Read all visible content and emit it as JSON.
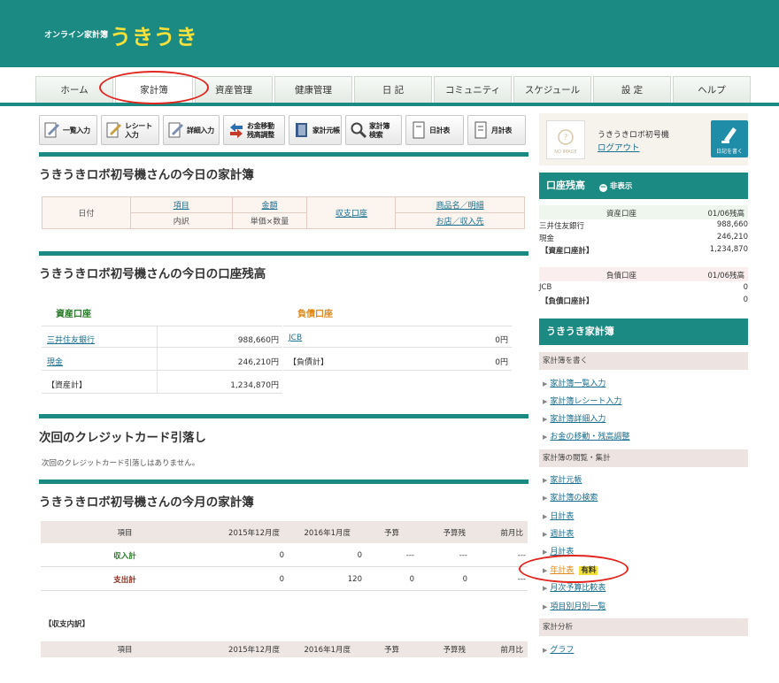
{
  "header": {
    "sub": "オンライン家計簿",
    "brand": "うきうき"
  },
  "tabs": [
    "ホーム",
    "家計簿",
    "資産管理",
    "健康管理",
    "日 記",
    "コミュニティ",
    "スケジュール",
    "設 定",
    "ヘルプ"
  ],
  "toolbar": [
    {
      "label": "一覧入力",
      "icon": "list-input-icon"
    },
    {
      "label": "レシート入力",
      "icon": "receipt-input-icon"
    },
    {
      "label": "詳細入力",
      "icon": "detail-input-icon"
    },
    {
      "label": "お金移動\n残高調整",
      "icon": "money-transfer-icon"
    },
    {
      "label": "家計元帳",
      "icon": "ledger-icon"
    },
    {
      "label": "家計簿\n検索",
      "icon": "search-icon"
    },
    {
      "label": "日計表",
      "icon": "daily-report-icon"
    },
    {
      "label": "月計表",
      "icon": "monthly-report-icon"
    }
  ],
  "today_book": {
    "title": "うきうきロボ初号機さんの今日の家計簿",
    "h_date": "日付",
    "h_item": "項目",
    "h_amount": "金額",
    "h_account": "収支口座",
    "h_product": "商品名／明細",
    "h_detail": "内訳",
    "h_qty": "単価×数量",
    "h_shop": "お店／収入先"
  },
  "balance": {
    "title": "うきうきロボ初号機さんの今日の口座残高",
    "asset_head": "資産口座",
    "debt_head": "負債口座",
    "assets": [
      {
        "name": "三井住友銀行",
        "value": "988,660円"
      },
      {
        "name": "現金",
        "value": "246,210円"
      },
      {
        "name": "【資産計】",
        "value": "1,234,870円"
      }
    ],
    "debts": [
      {
        "name": "JCB",
        "value": "0円"
      },
      {
        "name": "【負債計】",
        "value": "0円"
      }
    ]
  },
  "credit": {
    "title": "次回のクレジットカード引落し",
    "message": "次回のクレジットカード引落しはありません。"
  },
  "monthly": {
    "title": "うきうきロボ初号機さんの今月の家計簿",
    "headers": [
      "項目",
      "2015年12月度",
      "2016年1月度",
      "予算",
      "予算残",
      "前月比"
    ],
    "rows": [
      {
        "name": "収入計",
        "v": [
          "0",
          "0",
          "---",
          "---",
          "---"
        ]
      },
      {
        "name": "支出計",
        "v": [
          "0",
          "120",
          "0",
          "0",
          "---"
        ]
      }
    ],
    "breakdown_label": "【収支内訳】",
    "headers2": [
      "項目",
      "2015年12月度",
      "2016年1月度",
      "予算",
      "予算残",
      "前月比"
    ]
  },
  "profile": {
    "name": "うきうきロボ初号機",
    "logout": "ログアウト",
    "diary": "日記を書く",
    "noimage": "NO IMAGE"
  },
  "side_balance": {
    "title": "口座残高",
    "toggle": "非表示",
    "asset_head": "資産口座",
    "asset_date": "01/06残高",
    "assets": [
      {
        "name": "三井住友銀行",
        "value": "988,660"
      },
      {
        "name": "現金",
        "value": "246,210"
      },
      {
        "name": "【資産口座計】",
        "value": "1,234,870"
      }
    ],
    "debt_head": "負債口座",
    "debt_date": "01/06残高",
    "debts": [
      {
        "name": "JCB",
        "value": "0"
      },
      {
        "name": "【負債口座計】",
        "value": "0"
      }
    ]
  },
  "side_menu": {
    "title": "うきうき家計簿",
    "group1": "家計簿を書く",
    "links1": [
      "家計簿一覧入力",
      "家計簿レシート入力",
      "家計簿詳細入力",
      "お金の移動・残高調整"
    ],
    "group2": "家計簿の閲覧・集計",
    "links2": [
      "家計元帳",
      "家計簿の検索",
      "日計表",
      "週計表",
      "月計表",
      "年計表",
      "月次予算比較表",
      "項目別月別一覧"
    ],
    "paid_badge": "有料",
    "group3": "家計分析",
    "links3": [
      "グラフ"
    ]
  }
}
